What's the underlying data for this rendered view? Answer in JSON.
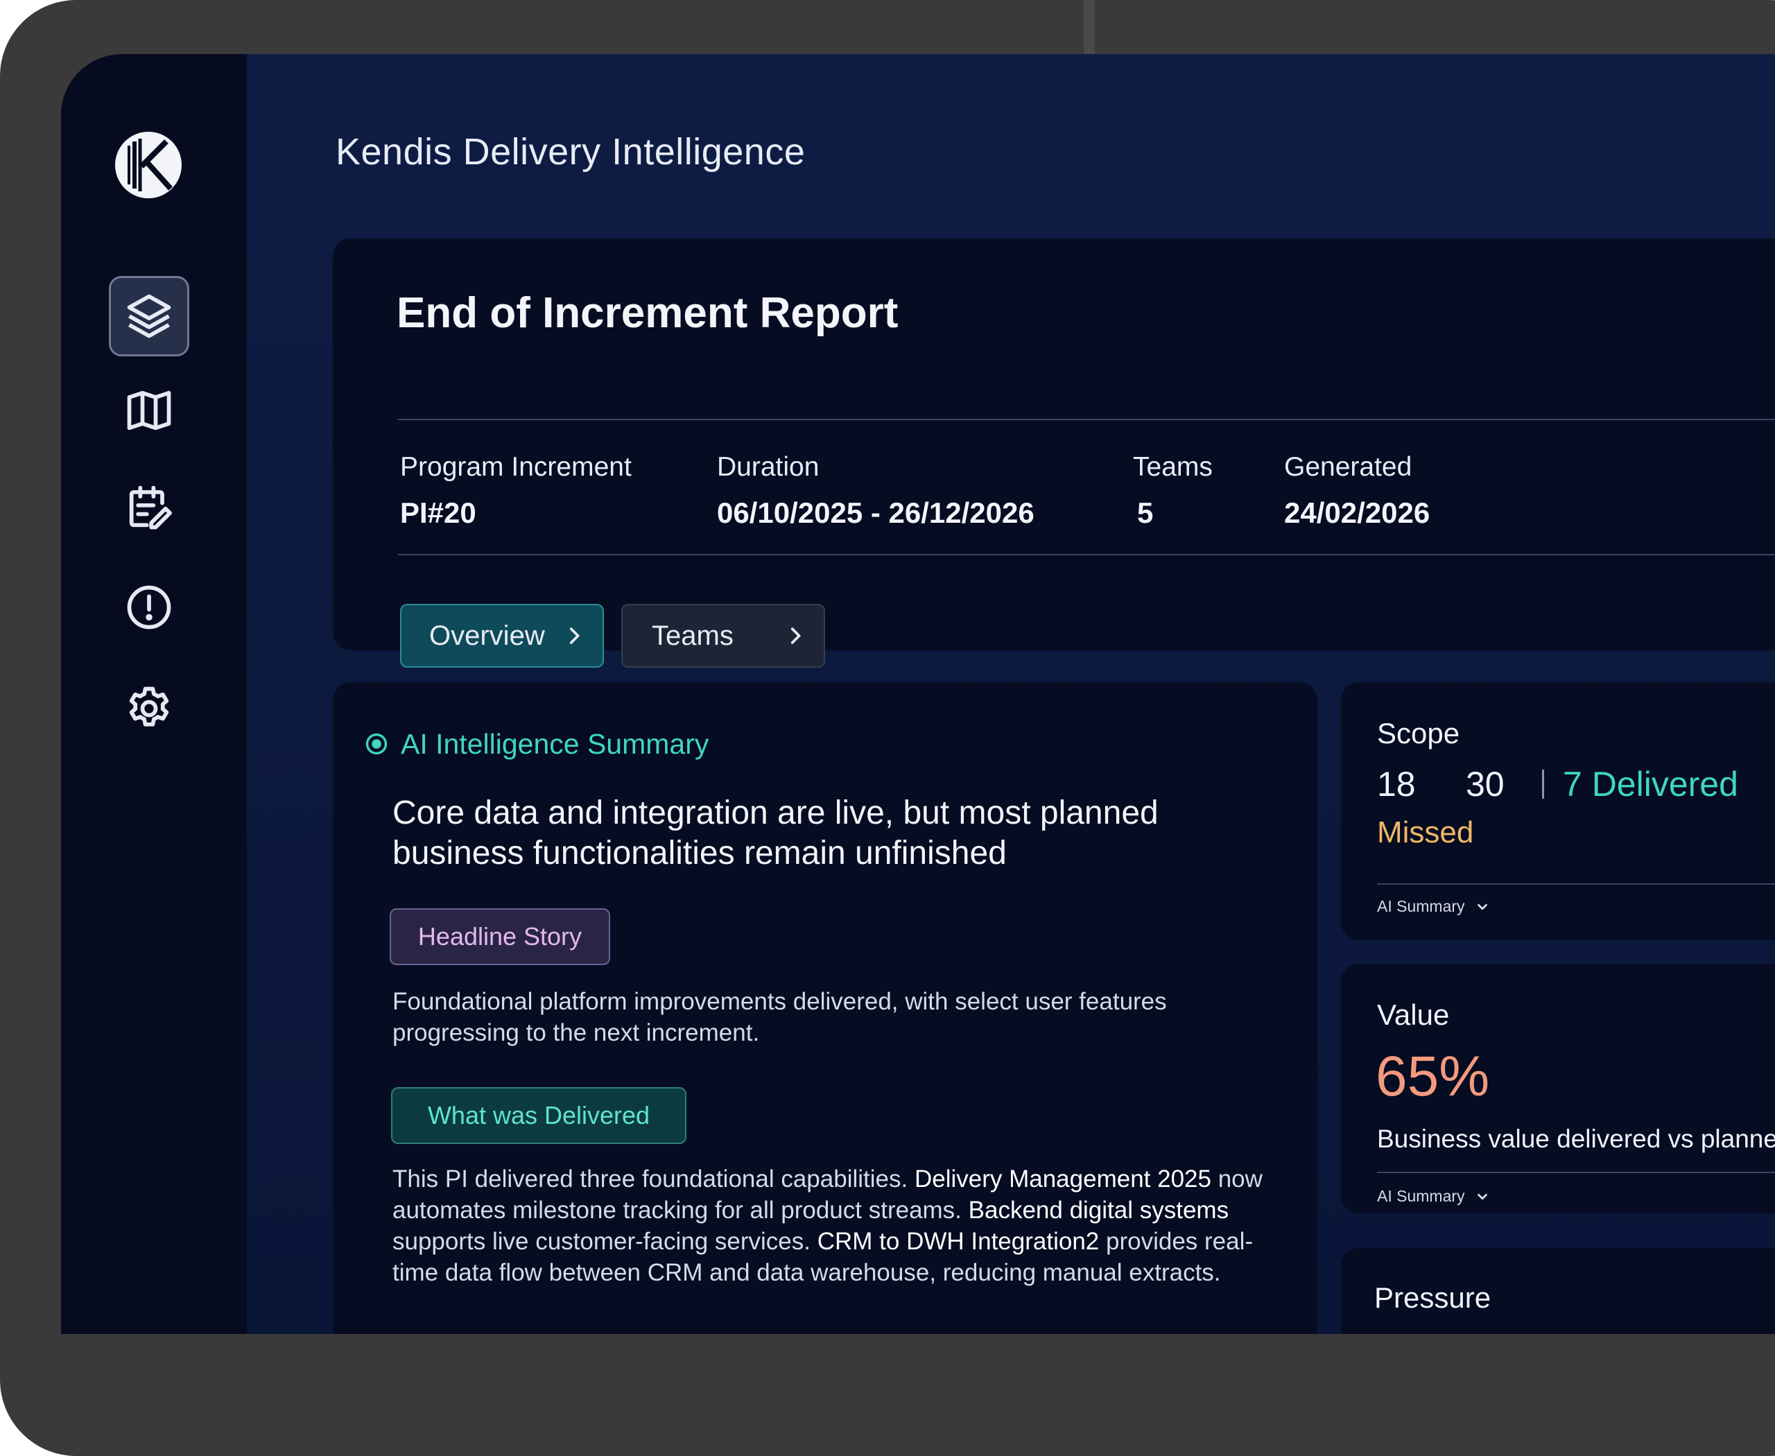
{
  "app": {
    "title": "Kendis Delivery Intelligence"
  },
  "sidebar": {
    "items": [
      {
        "icon": "layers-icon",
        "active": true
      },
      {
        "icon": "map-icon",
        "active": false
      },
      {
        "icon": "edit-notes-icon",
        "active": false
      },
      {
        "icon": "alert-circle-icon",
        "active": false
      },
      {
        "icon": "gear-icon",
        "active": false
      }
    ]
  },
  "report": {
    "title": "End of Increment Report",
    "meta": {
      "pi_label": "Program Increment",
      "pi_value": "PI#20",
      "duration_label": "Duration",
      "duration_value": "06/10/2025 - 26/12/2026",
      "teams_label": "Teams",
      "teams_value": "5",
      "generated_label": "Generated",
      "generated_value": "24/02/2026"
    },
    "buttons": {
      "overview": "Overview",
      "teams": "Teams"
    }
  },
  "summary": {
    "heading": "AI Intelligence Summary",
    "headline": "Core data and integration are live, but most planned business functionalities remain unfinished",
    "tag_headline": "Headline Story",
    "headline_text": "Foundational platform improvements delivered, with select user features progressing to the next increment.",
    "tag_delivered": "What was Delivered",
    "delivered_parts": {
      "p1": "This PI delivered three foundational capabilities. ",
      "b1": "Delivery Management 2025",
      "p2": " now automates milestone tracking for all product streams. ",
      "b2": "Backend digital systems",
      "p3": " supports live customer-facing services. ",
      "b3": "CRM to DWH Integration2",
      "p4": " provides real-time data flow between CRM and data warehouse, reducing manual extracts."
    }
  },
  "scope": {
    "title": "Scope",
    "n1": "18",
    "n2": "30",
    "delivered": "7 Delivered",
    "missed": "Missed",
    "ai_summary": "AI Summary"
  },
  "value": {
    "title": "Value",
    "percent": "65%",
    "caption": "Business value delivered vs planned",
    "ai_summary": "AI Summary"
  },
  "pressure": {
    "title": "Pressure"
  },
  "colors": {
    "accent_teal": "#3fd6c3",
    "missed_orange": "#f0b766",
    "value_salmon": "#f39a7e",
    "headline_tag_text": "#e3b8f0"
  }
}
